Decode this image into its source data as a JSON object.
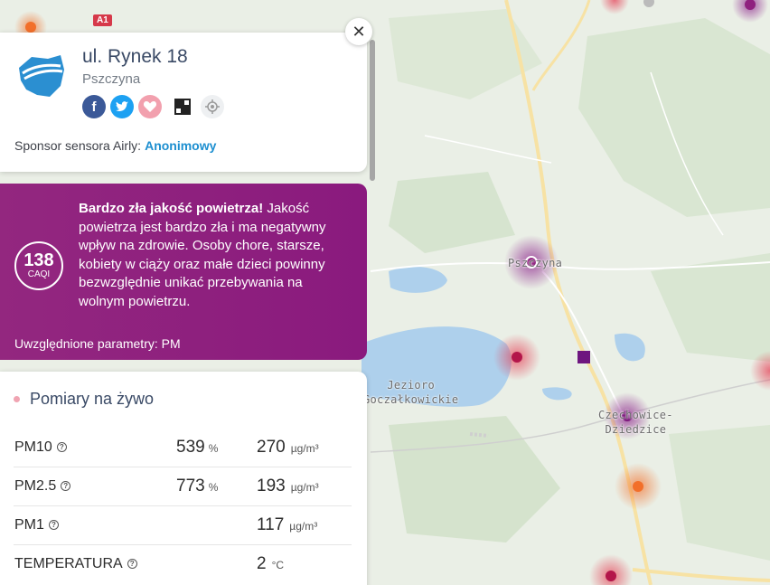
{
  "map": {
    "labels": {
      "pszczyna": "Pszczyna",
      "lake": "Jezioro\nGoczałkowickie",
      "czechowice": "Czechowice-\nDziedzice"
    },
    "road_badge": "A1"
  },
  "sensor": {
    "title": "ul. Rynek 18",
    "city": "Pszczyna",
    "share_icons": [
      "facebook-icon",
      "twitter-icon",
      "favorite-icon",
      "qr-code-icon",
      "locate-icon"
    ],
    "sponsor_label": "Sponsor sensora Airly:",
    "sponsor_name": "Anonimowy"
  },
  "alert": {
    "caqi_value": "138",
    "caqi_unit": "CAQI",
    "headline": "Bardzo zła jakość powietrza!",
    "message": "Jakość powietrza jest bardzo zła i ma negatywny wpływ na zdrowie. Osoby chore, starsze, kobiety w ciąży oraz małe dzieci powinny bezwzględnie unikać przebywania na wolnym powietrzu.",
    "params": "Uwzględnione parametry: PM",
    "color": "#8f217f"
  },
  "live": {
    "title": "Pomiary na żywo",
    "rows": [
      {
        "name": "PM10",
        "percent": "539",
        "percent_unit": "%",
        "value": "270",
        "unit": "µg/m³"
      },
      {
        "name": "PM2.5",
        "percent": "773",
        "percent_unit": "%",
        "value": "193",
        "unit": "µg/m³"
      },
      {
        "name": "PM1",
        "percent": "",
        "percent_unit": "",
        "value": "117",
        "unit": "µg/m³"
      },
      {
        "name": "TEMPERATURA",
        "percent": "",
        "percent_unit": "",
        "value": "2",
        "unit": "°C"
      }
    ]
  },
  "colors": {
    "very_bad": "#8f217f",
    "bad": "#c2185b",
    "moderate": "#f26f2a",
    "link": "#1d8fd0"
  }
}
